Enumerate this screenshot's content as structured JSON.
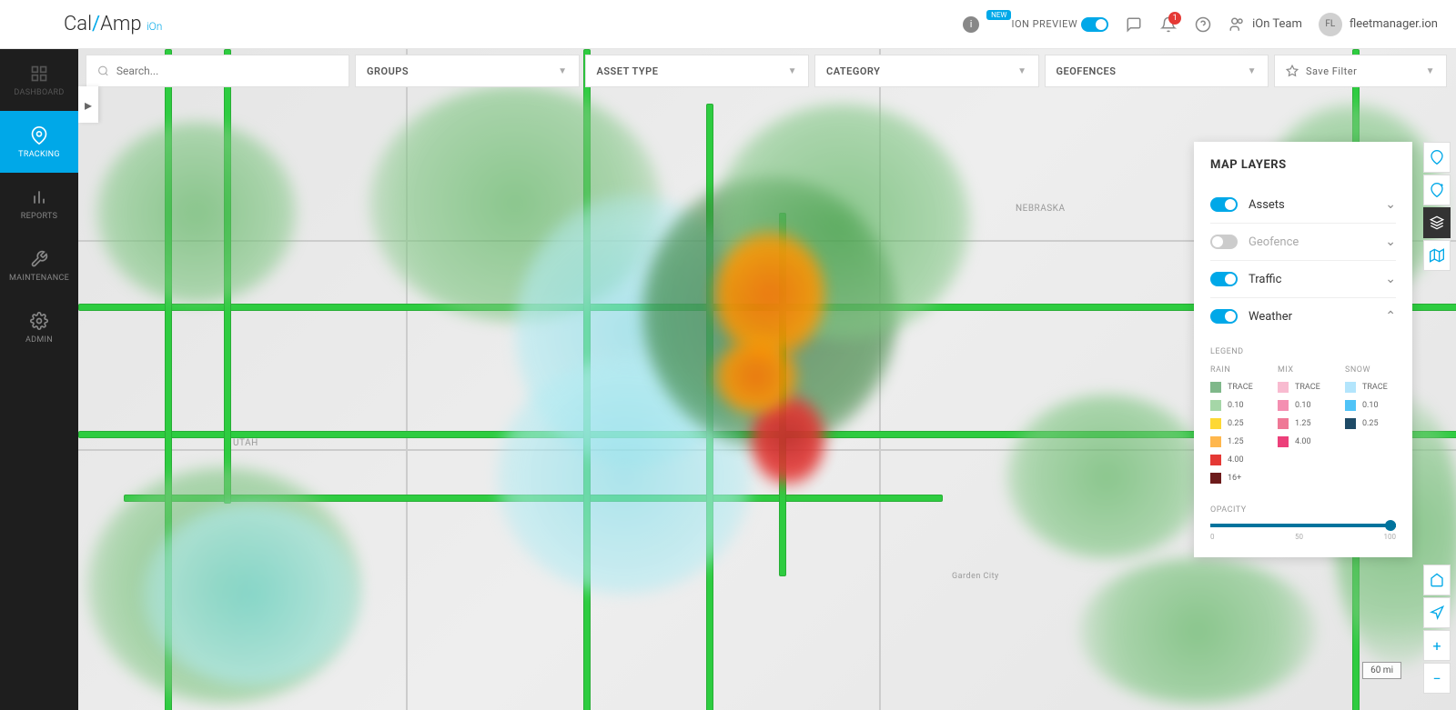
{
  "header": {
    "logo_prefix": "Cal",
    "logo_suffix": "Amp",
    "logo_sub": "iOn",
    "new_badge": "NEW",
    "preview_label": "ION PREVIEW",
    "team_label": "iOn Team",
    "user_initials": "FL",
    "username": "fleetmanager.ion",
    "notification_count": "1"
  },
  "sidebar": {
    "items": [
      {
        "label": "DASHBOARD"
      },
      {
        "label": "TRACKING"
      },
      {
        "label": "REPORTS"
      },
      {
        "label": "MAINTENANCE"
      },
      {
        "label": "ADMIN"
      }
    ]
  },
  "filters": {
    "search_placeholder": "Search...",
    "groups": "GROUPS",
    "asset_type": "ASSET TYPE",
    "category": "CATEGORY",
    "geofences": "GEOFENCES",
    "save_filter": "Save Filter"
  },
  "map": {
    "scale": "60 mi",
    "labels": {
      "utah": "UTAH",
      "nebraska": "NEBRASKA",
      "garden_city": "Garden City"
    }
  },
  "layers_panel": {
    "title": "MAP LAYERS",
    "layers": [
      {
        "label": "Assets",
        "on": true,
        "expanded": false
      },
      {
        "label": "Geofence",
        "on": false,
        "expanded": false
      },
      {
        "label": "Traffic",
        "on": true,
        "expanded": false
      },
      {
        "label": "Weather",
        "on": true,
        "expanded": true
      }
    ],
    "legend_title": "LEGEND",
    "rain_title": "RAIN",
    "mix_title": "MIX",
    "snow_title": "SNOW",
    "rain": [
      {
        "label": "TRACE",
        "color": "#7fb88a"
      },
      {
        "label": "0.10",
        "color": "#a5d6a7"
      },
      {
        "label": "0.25",
        "color": "#fdd835"
      },
      {
        "label": "1.25",
        "color": "#ffb74d"
      },
      {
        "label": "4.00",
        "color": "#e53935"
      },
      {
        "label": "16+",
        "color": "#6d1b1b"
      }
    ],
    "mix": [
      {
        "label": "TRACE",
        "color": "#f8bbd0"
      },
      {
        "label": "0.10",
        "color": "#f48fb1"
      },
      {
        "label": "1.25",
        "color": "#ef7896"
      },
      {
        "label": "4.00",
        "color": "#ec407a"
      }
    ],
    "snow": [
      {
        "label": "TRACE",
        "color": "#b3e5fc"
      },
      {
        "label": "0.10",
        "color": "#4fc3f7"
      },
      {
        "label": "0.25",
        "color": "#1e4a66"
      }
    ],
    "opacity_title": "OPACITY",
    "opacity_min": "0",
    "opacity_mid": "50",
    "opacity_max": "100"
  }
}
